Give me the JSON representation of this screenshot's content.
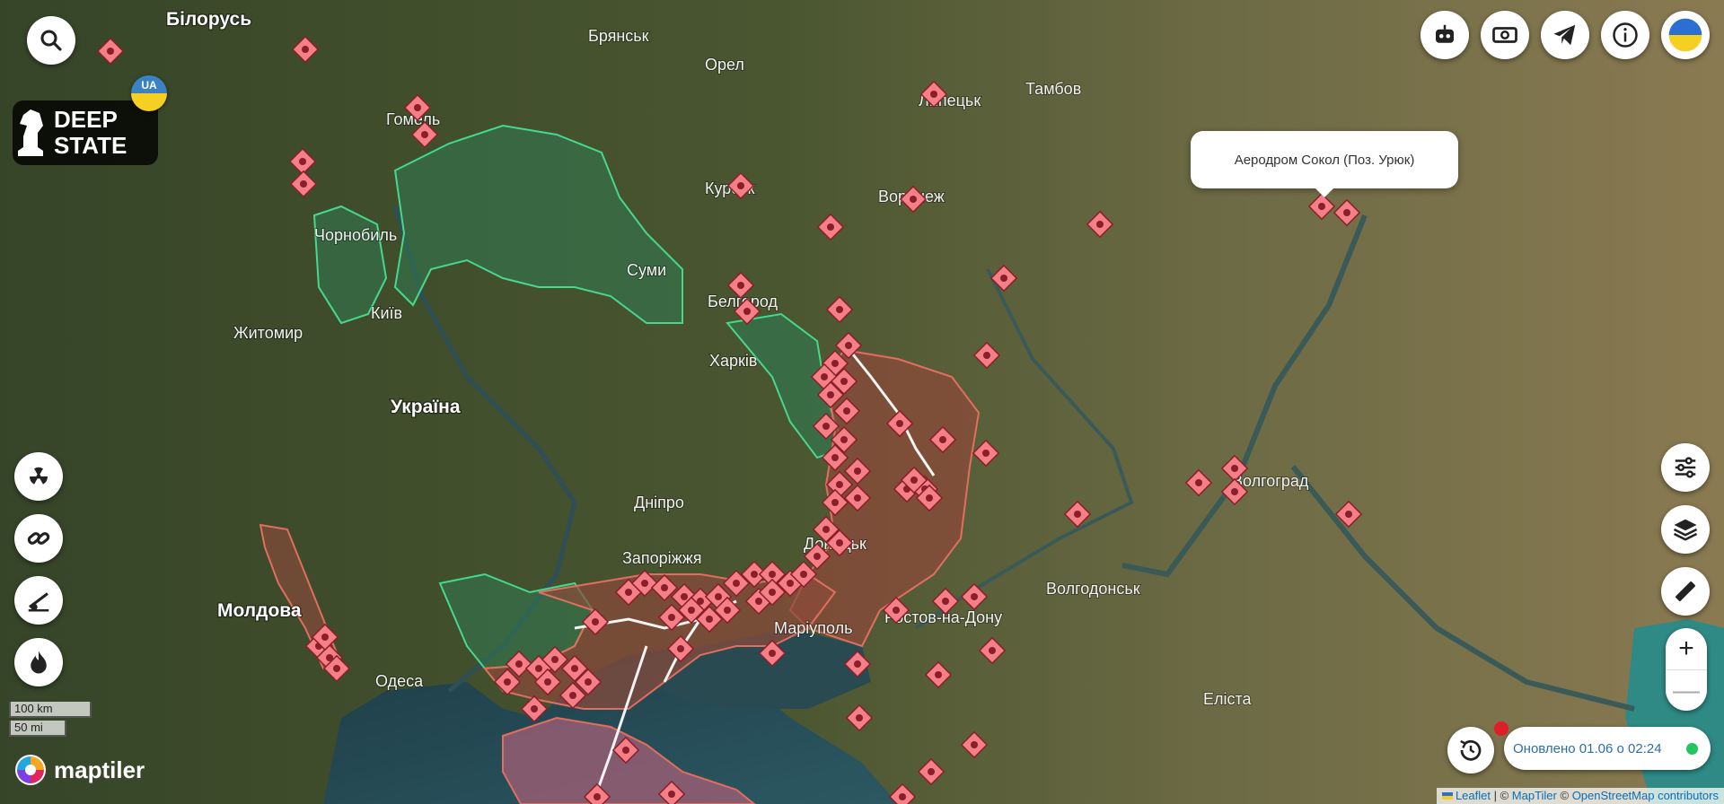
{
  "map": {
    "city_labels": [
      {
        "key": "bilorus",
        "text": "Білорусь",
        "kind": "country"
      },
      {
        "key": "bryansk",
        "text": "Брянськ",
        "kind": "city"
      },
      {
        "key": "orel",
        "text": "Орел",
        "kind": "city"
      },
      {
        "key": "lipetsk",
        "text": "Липецьк",
        "kind": "city"
      },
      {
        "key": "tambov",
        "text": "Тамбов",
        "kind": "city"
      },
      {
        "key": "gomel",
        "text": "Гомель",
        "kind": "city"
      },
      {
        "key": "kursk",
        "text": "Курськ",
        "kind": "city"
      },
      {
        "key": "voronezh",
        "text": "Воронеж",
        "kind": "city"
      },
      {
        "key": "chornobyl",
        "text": "Чорнобиль",
        "kind": "city"
      },
      {
        "key": "sumy",
        "text": "Суми",
        "kind": "city"
      },
      {
        "key": "belgorod",
        "text": "Белгород",
        "kind": "city"
      },
      {
        "key": "zhytomyr",
        "text": "Житомир",
        "kind": "city"
      },
      {
        "key": "kyiv",
        "text": "Київ",
        "kind": "city"
      },
      {
        "key": "kharkiv",
        "text": "Харків",
        "kind": "city"
      },
      {
        "key": "ukraine",
        "text": "Україна",
        "kind": "country"
      },
      {
        "key": "volgograd",
        "text": "Волгоград",
        "kind": "city"
      },
      {
        "key": "dnipro",
        "text": "Дніпро",
        "kind": "city"
      },
      {
        "key": "donetsk",
        "text": "Донецьк",
        "kind": "city"
      },
      {
        "key": "zaporizhzhia",
        "text": "Запоріжжя",
        "kind": "city"
      },
      {
        "key": "volgodonsk",
        "text": "Волгодонськ",
        "kind": "city"
      },
      {
        "key": "moldova",
        "text": "Молдова",
        "kind": "country"
      },
      {
        "key": "mariupol",
        "text": "Маріуполь",
        "kind": "city"
      },
      {
        "key": "rostov",
        "text": "Ростов-на-Дону",
        "kind": "city"
      },
      {
        "key": "odesa",
        "text": "Одеса",
        "kind": "city"
      },
      {
        "key": "elista",
        "text": "Еліста",
        "kind": "city"
      }
    ],
    "popup_text": "Аеродром Сокол (Поз. Урюк)",
    "colors": {
      "occupied_fill": "#8b4a3a",
      "occupied_stroke": "#e06f5f",
      "liberated_fill": "#2f7a52",
      "liberated_stroke": "#45d98d",
      "crimea_fill": "#9c5e74",
      "marker_fill": "#f47f86",
      "marker_stroke": "#8a1e2a",
      "sea": "#1f3b45",
      "land_west": "#3c4a2a",
      "land_east": "#72704a"
    }
  },
  "controls": {
    "left": [
      {
        "key": "search",
        "icon": "search-icon"
      },
      {
        "key": "radiation",
        "icon": "radiation-icon"
      },
      {
        "key": "link",
        "icon": "link-icon"
      },
      {
        "key": "artillery",
        "icon": "artillery-icon"
      },
      {
        "key": "fire",
        "icon": "fire-icon"
      }
    ],
    "right_top": [
      {
        "key": "robot",
        "icon": "robot-icon"
      },
      {
        "key": "donate",
        "icon": "money-icon"
      },
      {
        "key": "telegram",
        "icon": "telegram-icon"
      },
      {
        "key": "info",
        "icon": "info-icon"
      },
      {
        "key": "language",
        "icon": "ukraine-flag-icon"
      }
    ],
    "right_side": [
      {
        "key": "filters",
        "icon": "sliders-icon"
      },
      {
        "key": "layers",
        "icon": "layers-icon"
      },
      {
        "key": "ruler",
        "icon": "ruler-icon"
      }
    ],
    "zoom_in": "+",
    "zoom_out": "—"
  },
  "logo": {
    "line1": "DEEP",
    "line2": "STATE",
    "badge": "UA"
  },
  "status": {
    "updated_text": "Оновлено 01.06 о 02:24"
  },
  "scale": {
    "km": "100 km",
    "mi": "50 mi"
  },
  "maptiler": {
    "word": "maptiler"
  },
  "attribution": {
    "leaflet": "Leaflet",
    "sep1": " | © ",
    "maptiler": "MapTiler",
    "sep2": " © ",
    "osm": "OpenStreetMap contributors"
  }
}
